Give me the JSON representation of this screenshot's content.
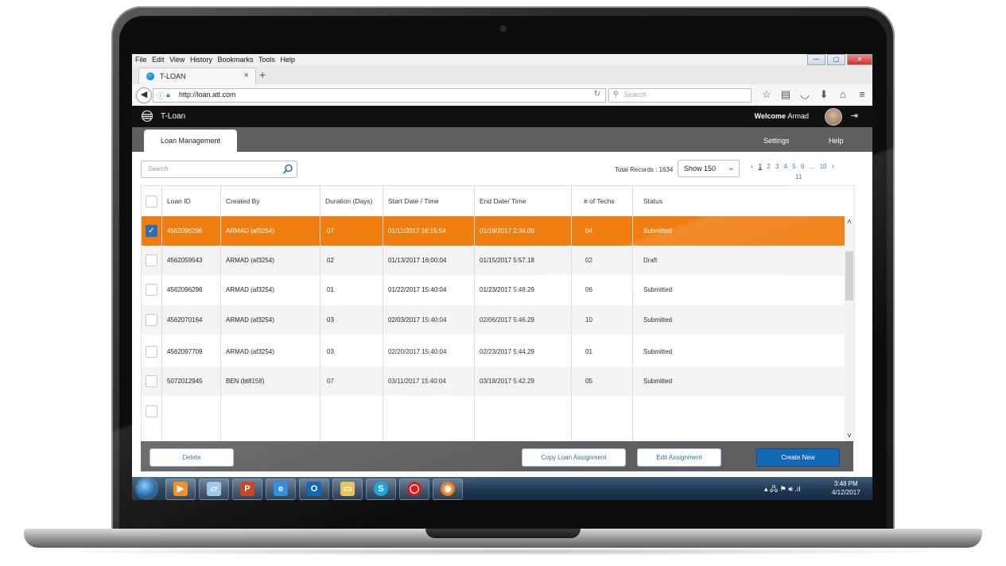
{
  "browser": {
    "menu": [
      "File",
      "Edit",
      "View",
      "History",
      "Bookmarks",
      "Tools",
      "Help"
    ],
    "tab_title": "T-LOAN",
    "tab_close": "×",
    "new_tab": "+",
    "url": "http://loan.att.com",
    "search_placeholder": "Search",
    "window_controls": [
      "—",
      "▢",
      "✕"
    ]
  },
  "app": {
    "title": "T-Loan",
    "welcome_label": "Welcome",
    "user_name": "Armad",
    "tab_active": "Loan Management",
    "nav_settings": "Settings",
    "nav_help": "Help"
  },
  "toolbar": {
    "search_placeholder": "Search",
    "total_records": "Total Records : 1634",
    "show_label": "Show",
    "show_value": "150",
    "pages": [
      "1",
      "2",
      "3",
      "4",
      "5",
      "6",
      "...",
      "10"
    ],
    "current_page": "1",
    "page_extra": "11"
  },
  "table": {
    "columns": [
      "Loan ID",
      "Created By",
      "Duration (Days)",
      "Start Date / Time",
      "End Date/ Time",
      "# of Techs",
      "Status"
    ],
    "rows": [
      {
        "id": "4562096296",
        "by": "ARMAD (af3254)",
        "dur": "07",
        "start": "01/11/2017  16:15:54",
        "end": "01/18/2017  2:34.00",
        "techs": "04",
        "status": "Submitted"
      },
      {
        "id": "4562059543",
        "by": "ARMAD (af3254)",
        "dur": "02",
        "start": "01/13/2017  16:00:04",
        "end": "01/15/2017  5:57.18",
        "techs": "02",
        "status": "Draft"
      },
      {
        "id": "4562096296",
        "by": "ARMAD (af3254)",
        "dur": "01",
        "start": "01/22/2017  15:40:04",
        "end": "01/23/2017  5:48.29",
        "techs": "06",
        "status": "Submitted"
      },
      {
        "id": "4562070164",
        "by": "ARMAD (af3254)",
        "dur": "03",
        "start": "02/03/2017  15:40:04",
        "end": "02/06/2017  5:46.29",
        "techs": "10",
        "status": "Submitted"
      },
      {
        "id": "4562097709",
        "by": "ARMAD (af3254)",
        "dur": "03",
        "start": "02/20/2017  15:40:04",
        "end": "02/23/2017  5:44.29",
        "techs": "01",
        "status": "Submitted"
      },
      {
        "id": "5072012945",
        "by": "BEN (bt8158)",
        "dur": "07",
        "start": "03/11/2017  15:40:04",
        "end": "03/18/2017  5:42.29",
        "techs": "05",
        "status": "Submitted"
      }
    ]
  },
  "actions": {
    "delete": "Delete",
    "copy": "Copy Loan Assignment",
    "edit": "Edit Assignment",
    "create": "Create New"
  },
  "taskbar": {
    "time": "3:48 PM",
    "date": "4/12/2017"
  },
  "colors": {
    "selected_row": "#f07d10",
    "primary_button": "#1469b6",
    "subnav": "#5f5f5f"
  }
}
